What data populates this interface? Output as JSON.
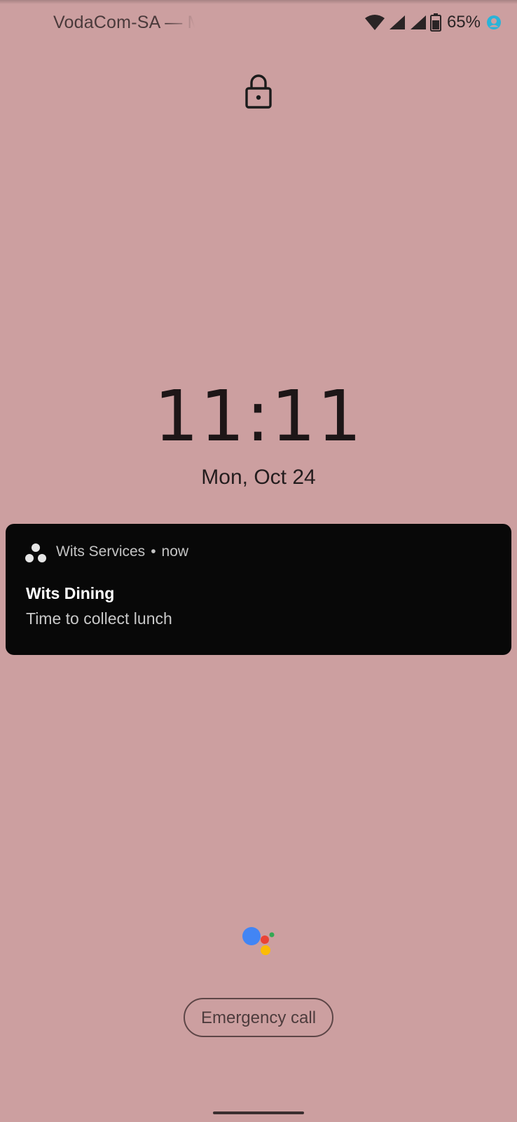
{
  "status_bar": {
    "carrier": "VodaCom-SA — M",
    "battery_percent": "65%",
    "icons": [
      "wifi-icon",
      "signal-icon",
      "signal-icon",
      "battery-icon",
      "account-icon"
    ],
    "colors": {
      "account_icon": "#2bb3d8"
    }
  },
  "lockscreen": {
    "lock_icon": "lock-icon",
    "time": "11:11",
    "date": "Mon, Oct 24"
  },
  "notification": {
    "app_icon": "wits-services-icon",
    "app_name": "Wits Services",
    "separator": "•",
    "time": "now",
    "title": "Wits Dining",
    "body": "Time to collect lunch"
  },
  "bottom": {
    "assistant_icon": "google-assistant-icon",
    "emergency_label": "Emergency call",
    "assistant_colors": {
      "blue": "#4285f4",
      "red": "#ea4335",
      "yellow": "#fbbc04",
      "green": "#34a853"
    }
  },
  "colors": {
    "wallpaper": "#cc9fa0",
    "notification_bg": "#080808"
  }
}
